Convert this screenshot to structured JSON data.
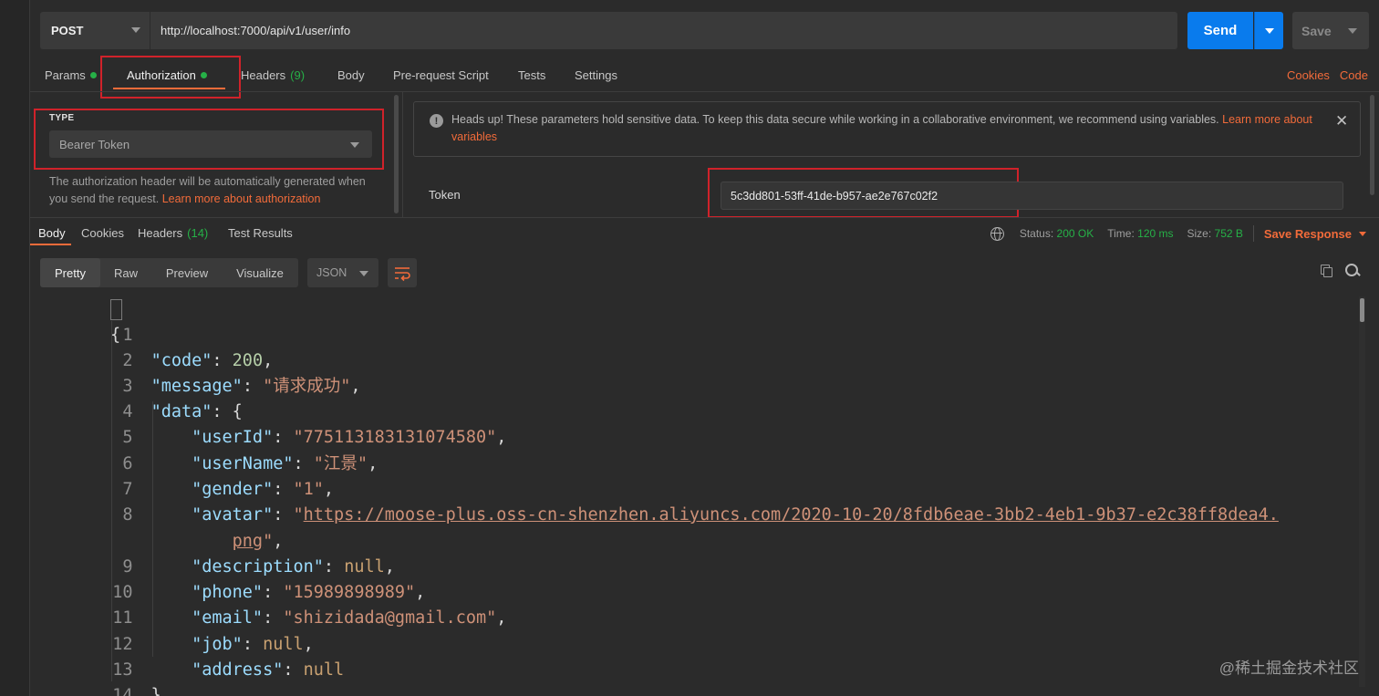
{
  "request": {
    "method": "POST",
    "url": "http://localhost:7000/api/v1/user/info",
    "send_label": "Send",
    "save_label": "Save"
  },
  "request_tabs": [
    {
      "label": "Params",
      "dot": true
    },
    {
      "label": "Authorization",
      "dot": true,
      "active": true
    },
    {
      "label": "Headers",
      "count": "(9)"
    },
    {
      "label": "Body"
    },
    {
      "label": "Pre-request Script"
    },
    {
      "label": "Tests"
    },
    {
      "label": "Settings"
    }
  ],
  "right_links": {
    "cookies": "Cookies",
    "code": "Code"
  },
  "auth": {
    "type_label": "TYPE",
    "type_value": "Bearer Token",
    "description": "The authorization header will be automatically generated when you send the request. ",
    "description_link": "Learn more about authorization",
    "headsup_text": "Heads up! These parameters hold sensitive data. To keep this data secure while working in a collaborative environment, we recommend using variables. ",
    "headsup_link": "Learn more about variables",
    "token_label": "Token",
    "token_value": "5c3dd801-53ff-41de-b957-ae2e767c02f2"
  },
  "response_tabs": [
    {
      "label": "Body",
      "active": true
    },
    {
      "label": "Cookies"
    },
    {
      "label": "Headers",
      "count": "(14)"
    },
    {
      "label": "Test Results"
    }
  ],
  "response_status": {
    "status_label": "Status:",
    "status_value": "200 OK",
    "time_label": "Time:",
    "time_value": "120 ms",
    "size_label": "Size:",
    "size_value": "752 B",
    "save_response": "Save Response"
  },
  "view_modes": [
    "Pretty",
    "Raw",
    "Preview",
    "Visualize"
  ],
  "format": "JSON",
  "code_lines": [
    {
      "n": "1"
    },
    {
      "n": "2"
    },
    {
      "n": "3"
    },
    {
      "n": "4"
    },
    {
      "n": "5"
    },
    {
      "n": "6"
    },
    {
      "n": "7"
    },
    {
      "n": "8"
    },
    {
      "n": "9"
    },
    {
      "n": "10"
    },
    {
      "n": "11"
    },
    {
      "n": "12"
    },
    {
      "n": "13"
    },
    {
      "n": "14"
    }
  ],
  "json": {
    "code": "200",
    "message": "\"请求成功\"",
    "userId": "\"775113183131074580\"",
    "userName": "\"江景\"",
    "gender": "\"1\"",
    "avatar_a": "https://moose-plus.oss-cn-shenzhen.aliyuncs.com/2020-10-20/8fdb6eae-3bb2-4eb1-9b37-e2c38ff8dea4.",
    "avatar_b": "png",
    "phone": "\"15989898989\"",
    "email": "\"shizidada@gmail.com\"",
    "null": "null"
  },
  "watermark": "@稀土掘金技术社区"
}
